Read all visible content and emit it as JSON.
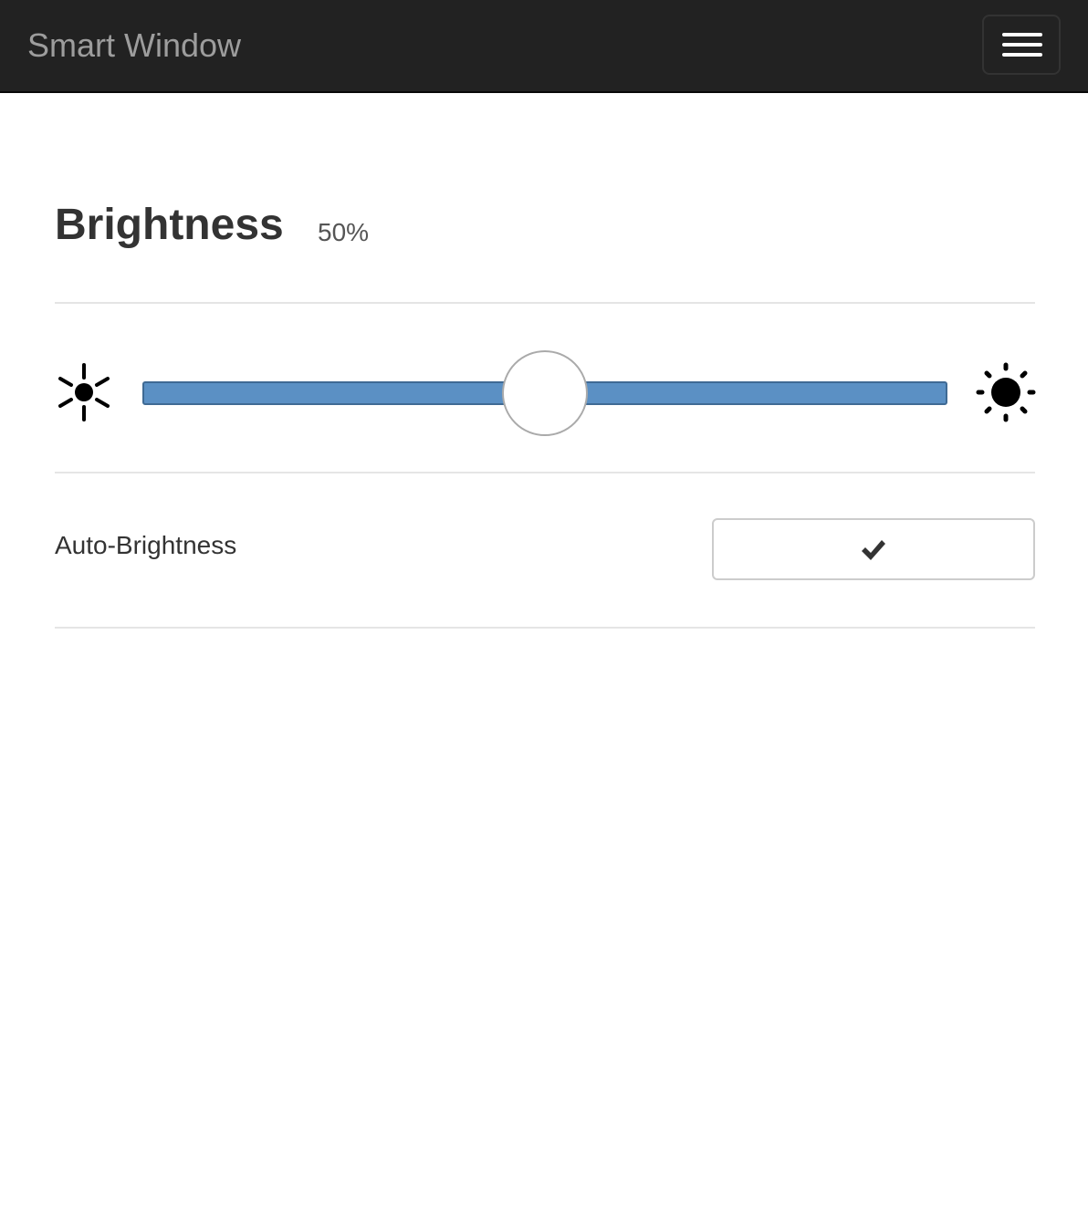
{
  "navbar": {
    "brand": "Smart Window",
    "menu_icon": "hamburger-menu-icon"
  },
  "brightness": {
    "title": "Brightness",
    "value_label": "50%",
    "value_fraction": 0.5,
    "min_icon": "sun-small-icon",
    "max_icon": "sun-large-icon",
    "track_color": "#5b90c4"
  },
  "auto_brightness": {
    "label": "Auto-Brightness",
    "checked": true,
    "check_icon": "checkmark-icon"
  }
}
